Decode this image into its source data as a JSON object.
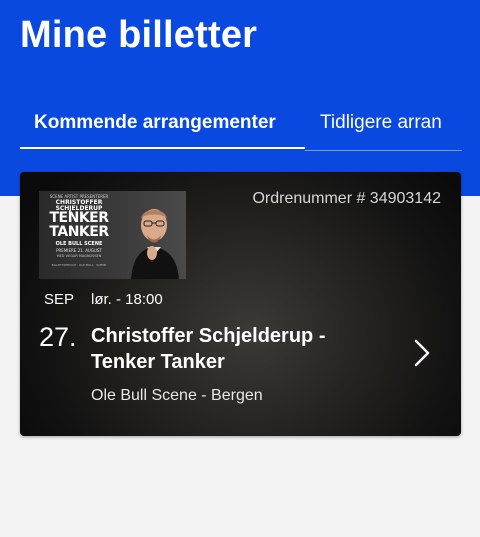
{
  "header": {
    "title": "Mine billetter",
    "background": "#0a49e0"
  },
  "tabs": [
    {
      "label": "Kommende arrangementer",
      "active": true
    },
    {
      "label": "Tidligere arran",
      "active": false
    }
  ],
  "ticket": {
    "order_number": "Ordrenummer # 34903142",
    "month": "SEP",
    "weekday_time": "lør. - 18:00",
    "day": "27.",
    "title": "Christoffer Schjelderup - Tenker Tanker",
    "venue": "Ole Bull Scene - Bergen",
    "poster": {
      "top_text": "SCENE ARTIST PRESENTERER",
      "name": "CHRISTOFFER SCHJELDERUP",
      "big_title": "TENKER TANKER",
      "scene": "OLE BULL SCENE",
      "premiere": "PREMIERE 21. AUGUST",
      "with": "MED VEGAR MAGNUSSEN",
      "logos": "BILLETTSERVICE · OLE BULL · SCENE"
    }
  },
  "icons": {
    "chevron": "chevron-right-icon"
  }
}
